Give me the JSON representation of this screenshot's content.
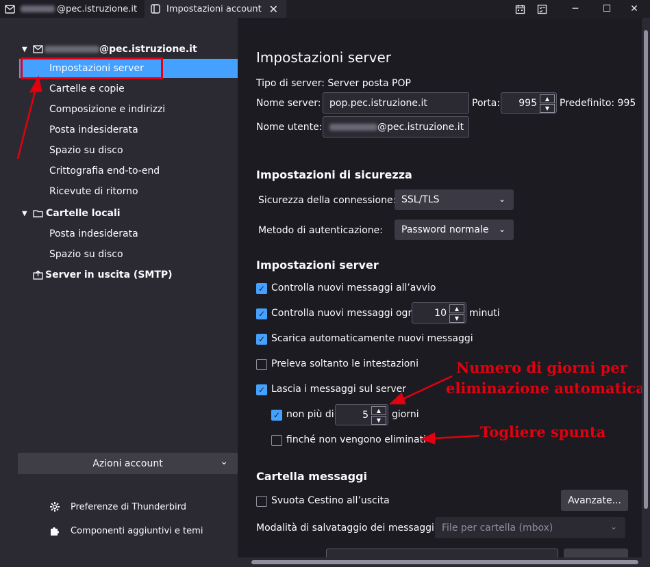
{
  "tabs": [
    {
      "label": "@pec.istruzione.it",
      "icon": "mail-icon"
    },
    {
      "label": "Impostazioni account",
      "icon": "settings-page-icon",
      "close": "✕"
    }
  ],
  "window_controls": {
    "minimize": "─",
    "maximize": "☐",
    "close": "✕"
  },
  "sidebar": {
    "account": {
      "label": "@pec.istruzione.it"
    },
    "account_items": [
      "Impostazioni server",
      "Cartelle e copie",
      "Composizione e indirizzi",
      "Posta indesiderata",
      "Spazio su disco",
      "Crittografia end-to-end",
      "Ricevute di ritorno"
    ],
    "local_folders": {
      "label": "Cartelle locali",
      "items": [
        "Posta indesiderata",
        "Spazio su disco"
      ]
    },
    "smtp": {
      "label": "Server in uscita (SMTP)"
    },
    "actions_button": "Azioni account",
    "footer": [
      {
        "label": "Preferenze di Thunderbird",
        "icon": "gear-icon"
      },
      {
        "label": "Componenti aggiuntivi e temi",
        "icon": "puzzle-icon"
      }
    ]
  },
  "main": {
    "title": "Impostazioni server",
    "server_type": "Tipo di server: Server posta POP",
    "server_name_label": "Nome server:",
    "server_name_value": "pop.pec.istruzione.it",
    "port_label": "Porta:",
    "port_value": "995",
    "default_label": "Predefinito: 995",
    "username_label": "Nome utente:",
    "username_value": "@pec.istruzione.it",
    "security_heading": "Impostazioni di sicurezza",
    "connection_security_label": "Sicurezza della connessione:",
    "connection_security_value": "SSL/TLS",
    "auth_method_label": "Metodo di autenticazione:",
    "auth_method_value": "Password normale",
    "server_settings_heading": "Impostazioni server",
    "check_on_startup": {
      "label": "Controlla nuovi messaggi all’avvio",
      "checked": true
    },
    "check_every": {
      "label": "Controlla nuovi messaggi ogni",
      "value": "10",
      "unit": "minuti",
      "checked": true
    },
    "auto_download": {
      "label": "Scarica automaticamente nuovi messaggi",
      "checked": true
    },
    "headers_only": {
      "label": "Preleva soltanto le intestazioni",
      "checked": false
    },
    "leave_on_server": {
      "label": "Lascia i messaggi sul server",
      "checked": true
    },
    "max_days": {
      "label": "non più di",
      "value": "5",
      "unit": "giorni",
      "checked": true
    },
    "until_deleted": {
      "label": "finché non vengono eliminati",
      "checked": false
    },
    "message_folder_heading": "Cartella messaggi",
    "empty_trash": {
      "label": "Svuota Cestino all’uscita",
      "checked": false
    },
    "advanced_button": "Avanzate...",
    "storage_label": "Modalità di salvataggio dei messaggi:",
    "storage_value": "File per cartella (mbox)"
  },
  "annotations": {
    "days_note_line1": "Numero di giorni per",
    "days_note_line2": "eliminazione automatica",
    "uncheck_note": "Togliere spunta",
    "color": "#e3000f"
  },
  "colors": {
    "accent": "#45a1ff",
    "sidebar_bg": "#2b2a33",
    "main_bg": "#1c1b22"
  }
}
